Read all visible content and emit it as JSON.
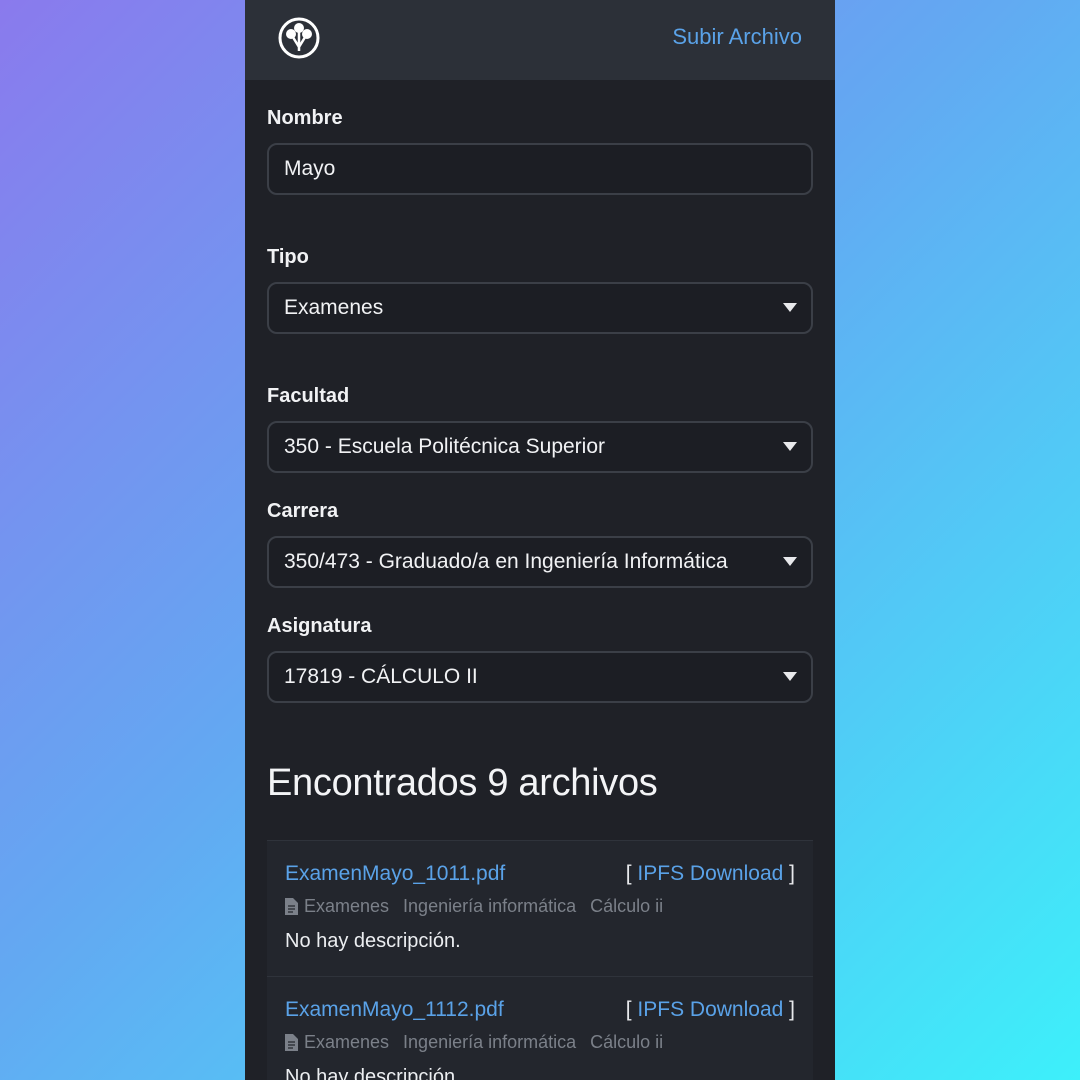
{
  "header": {
    "logo_icon": "tree-logo-icon",
    "upload_link": "Subir Archivo"
  },
  "form": {
    "nombre": {
      "label": "Nombre",
      "value": "Mayo"
    },
    "tipo": {
      "label": "Tipo",
      "value": "Examenes"
    },
    "facultad": {
      "label": "Facultad",
      "value": "350 - Escuela Politécnica Superior"
    },
    "carrera": {
      "label": "Carrera",
      "value": "350/473 - Graduado/a en Ingeniería Informática"
    },
    "asignatura": {
      "label": "Asignatura",
      "value": "17819 - CÁLCULO II"
    }
  },
  "results": {
    "title": "Encontrados 9 archivos",
    "files": [
      {
        "name": "ExamenMayo_1011.pdf",
        "download_open": "[",
        "download_label": "IPFS Download",
        "download_close": "]",
        "type": "Examenes",
        "career": "Ingeniería informática",
        "subject": "Cálculo ii",
        "description": "No hay descripción."
      },
      {
        "name": "ExamenMayo_1112.pdf",
        "download_open": "[",
        "download_label": "IPFS Download",
        "download_close": "]",
        "type": "Examenes",
        "career": "Ingeniería informática",
        "subject": "Cálculo ii",
        "description": "No hay descripción."
      }
    ]
  },
  "colors": {
    "accent": "#5aa2e8",
    "panel": "#1f2127",
    "header": "#2c3038"
  }
}
